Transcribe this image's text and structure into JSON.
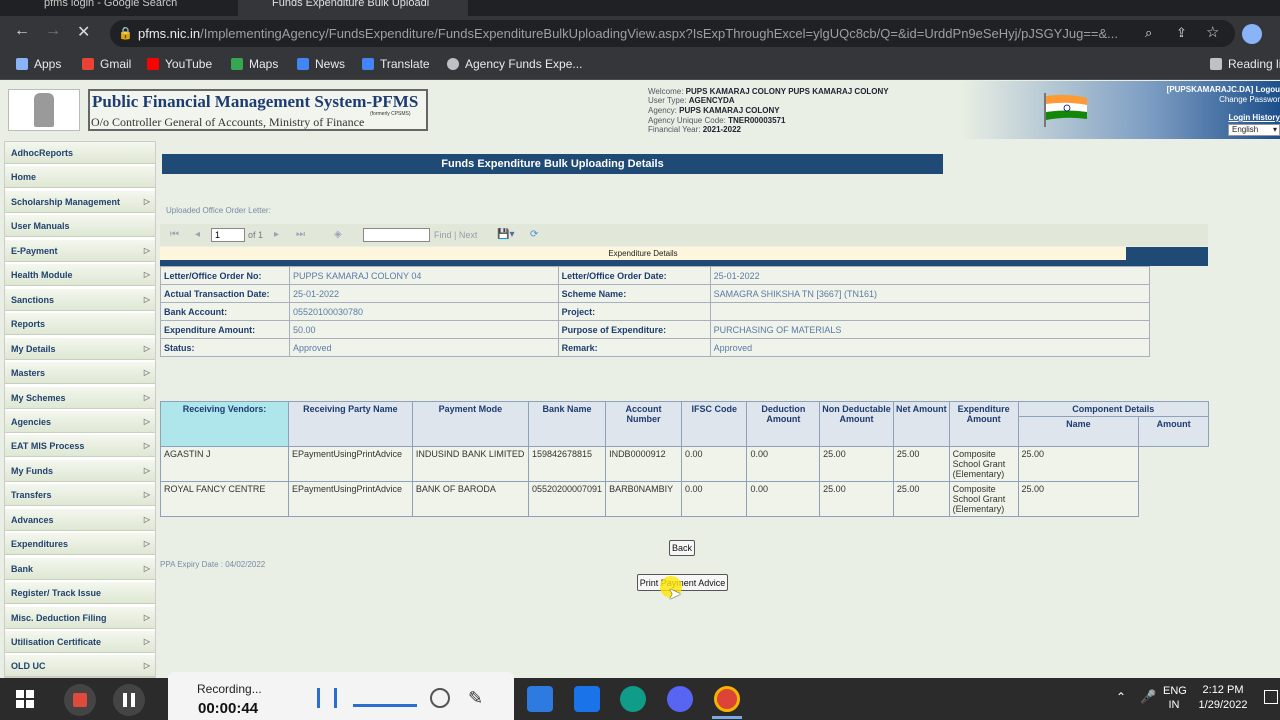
{
  "browser": {
    "tabs": [
      "pfms login - Google Search",
      "Funds Expenditure Bulk Uploadi"
    ],
    "url_host": "pfms.nic.in",
    "url_path": "/ImplementingAgency/FundsExpenditure/FundsExpenditureBulkUploadingView.aspx?IsExpThroughExcel=ylgUQc8cb/Q=&id=UrddPn9eSeHyj/pJSGYJug==&...",
    "bookmarks": [
      "Apps",
      "Gmail",
      "YouTube",
      "Maps",
      "News",
      "Translate",
      "Agency Funds Expe..."
    ],
    "reading_list": "Reading li",
    "colors": {
      "youtube": "#ff0000",
      "gmail": "#ea4335",
      "maps": "#34a853",
      "news": "#4285f4"
    }
  },
  "header": {
    "title": "Public Financial Management System-PFMS",
    "subtitle": "O/o Controller General of Accounts, Ministry of Finance",
    "formerly": "(formerly CPSMS)",
    "user": {
      "welcome_label": "Welcome:",
      "welcome": "PUPS KAMARAJ COLONY PUPS KAMARAJ COLONY",
      "type_label": "User Type:",
      "type": "AGENCYDA",
      "agency_label": "Agency:",
      "agency": "PUPS KAMARAJ COLONY",
      "code_label": "Agency Unique Code:",
      "code": "TNER00003571",
      "year_label": "Financial Year:",
      "year": "2021-2022"
    },
    "right": {
      "user_tag": "[PUPSKAMARAJC.DA]",
      "logout": "Logou",
      "change_password": "Change Passwor",
      "login_history": "Login History",
      "language": "English"
    }
  },
  "sidebar": {
    "items": [
      {
        "label": "AdhocReports",
        "arrow": ""
      },
      {
        "label": "Home",
        "arrow": ""
      },
      {
        "label": "Scholarship Management",
        "arrow": "▷"
      },
      {
        "label": "User Manuals",
        "arrow": ""
      },
      {
        "label": "E-Payment",
        "arrow": "▷"
      },
      {
        "label": "Health Module",
        "arrow": "▷"
      },
      {
        "label": "Sanctions",
        "arrow": "▷"
      },
      {
        "label": "Reports",
        "arrow": ""
      },
      {
        "label": "My Details",
        "arrow": "▷"
      },
      {
        "label": "Masters",
        "arrow": "▷"
      },
      {
        "label": "My Schemes",
        "arrow": "▷"
      },
      {
        "label": "Agencies",
        "arrow": "▷"
      },
      {
        "label": "EAT MIS Process",
        "arrow": "▷"
      },
      {
        "label": "My Funds",
        "arrow": "▷"
      },
      {
        "label": "Transfers",
        "arrow": "▷"
      },
      {
        "label": "Advances",
        "arrow": "▷"
      },
      {
        "label": "Expenditures",
        "arrow": "▷"
      },
      {
        "label": "Bank",
        "arrow": "▷"
      },
      {
        "label": "Register/ Track Issue",
        "arrow": ""
      },
      {
        "label": "Misc. Deduction Filing",
        "arrow": "▷"
      },
      {
        "label": "Utilisation Certificate",
        "arrow": "▷"
      },
      {
        "label": "OLD UC",
        "arrow": "▷"
      }
    ]
  },
  "main": {
    "title": "Funds Expenditure Bulk Uploading Details",
    "uploaded_label": "Uploaded Office Order Letter:",
    "report_toolbar": {
      "page": "1",
      "of_total": "of 1",
      "find_next": "Find | Next"
    },
    "expenditure_header": "Expenditure Details",
    "details": [
      {
        "k1": "Letter/Office Order No:",
        "v1": "PUPPS KAMARAJ COLONY  04",
        "k2": "Letter/Office Order Date:",
        "v2": "25-01-2022"
      },
      {
        "k1": "Actual Transaction Date:",
        "v1": "25-01-2022",
        "k2": "Scheme Name:",
        "v2": "SAMAGRA SHIKSHA TN [3667] (TN161)"
      },
      {
        "k1": "Bank Account:",
        "v1": "05520100030780",
        "k2": "Project:",
        "v2": ""
      },
      {
        "k1": "Expenditure Amount:",
        "v1": "50.00",
        "k2": "Purpose of Expenditure:",
        "v2": "PURCHASING OF MATERIALS"
      },
      {
        "k1": "Status:",
        "v1": "Approved",
        "k2": "Remark:",
        "v2": "Approved"
      }
    ],
    "vendors": {
      "row_label": "Receiving Vendors:",
      "headers": [
        "Receiving Party Name",
        "Payment Mode",
        "Bank Name",
        "Account Number",
        "IFSC Code",
        "Deduction Amount",
        "Non Deductable Amount",
        "Net Amount",
        "Expenditure Amount",
        "Component Details"
      ],
      "sub_headers": [
        "Name",
        "Amount"
      ],
      "rows": [
        [
          "AGASTIN J",
          "EPaymentUsingPrintAdvice",
          "INDUSIND BANK LIMITED",
          "159842678815",
          "INDB0000912",
          "0.00",
          "0.00",
          "25.00",
          "25.00",
          "Composite School Grant (Elementary)",
          "25.00"
        ],
        [
          "ROYAL FANCY CENTRE",
          "EPaymentUsingPrintAdvice",
          "BANK OF BARODA",
          "05520200007091",
          "BARB0NAMBIY",
          "0.00",
          "0.00",
          "25.00",
          "25.00",
          "Composite School Grant (Elementary)",
          "25.00"
        ]
      ]
    },
    "ppa_expiry": "PPA Expiry Date : 04/02/2022",
    "back_button": "Back",
    "print_button": "Print Payment Advice"
  },
  "taskbar": {
    "recording_label": "Recording...",
    "recording_time": "00:00:44",
    "tray_lang": "ENG",
    "tray_region": "IN",
    "time": "2:12 PM",
    "date": "1/29/2022"
  }
}
